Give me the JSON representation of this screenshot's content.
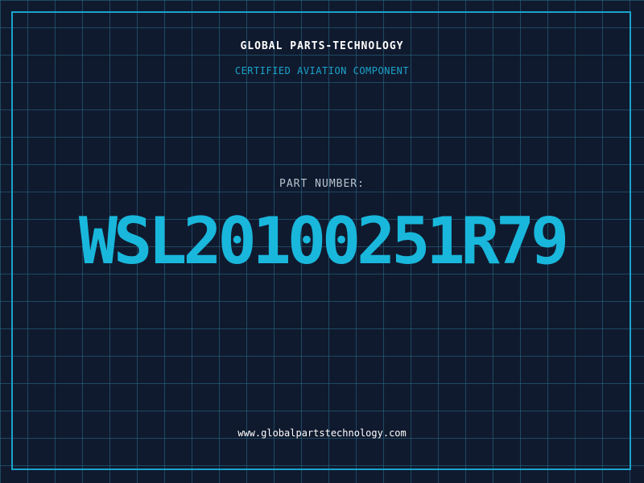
{
  "header": {
    "company": "GLOBAL PARTS-TECHNOLOGY",
    "subtitle": "CERTIFIED AVIATION COMPONENT"
  },
  "part": {
    "label": "PART NUMBER:",
    "number": "WSL20100251R79"
  },
  "footer": {
    "website": "www.globalpartstechnology.com"
  },
  "colors": {
    "background": "#101a2e",
    "accent": "#1ba3cc",
    "grid": "#286e8c",
    "text": "#ffffff"
  }
}
